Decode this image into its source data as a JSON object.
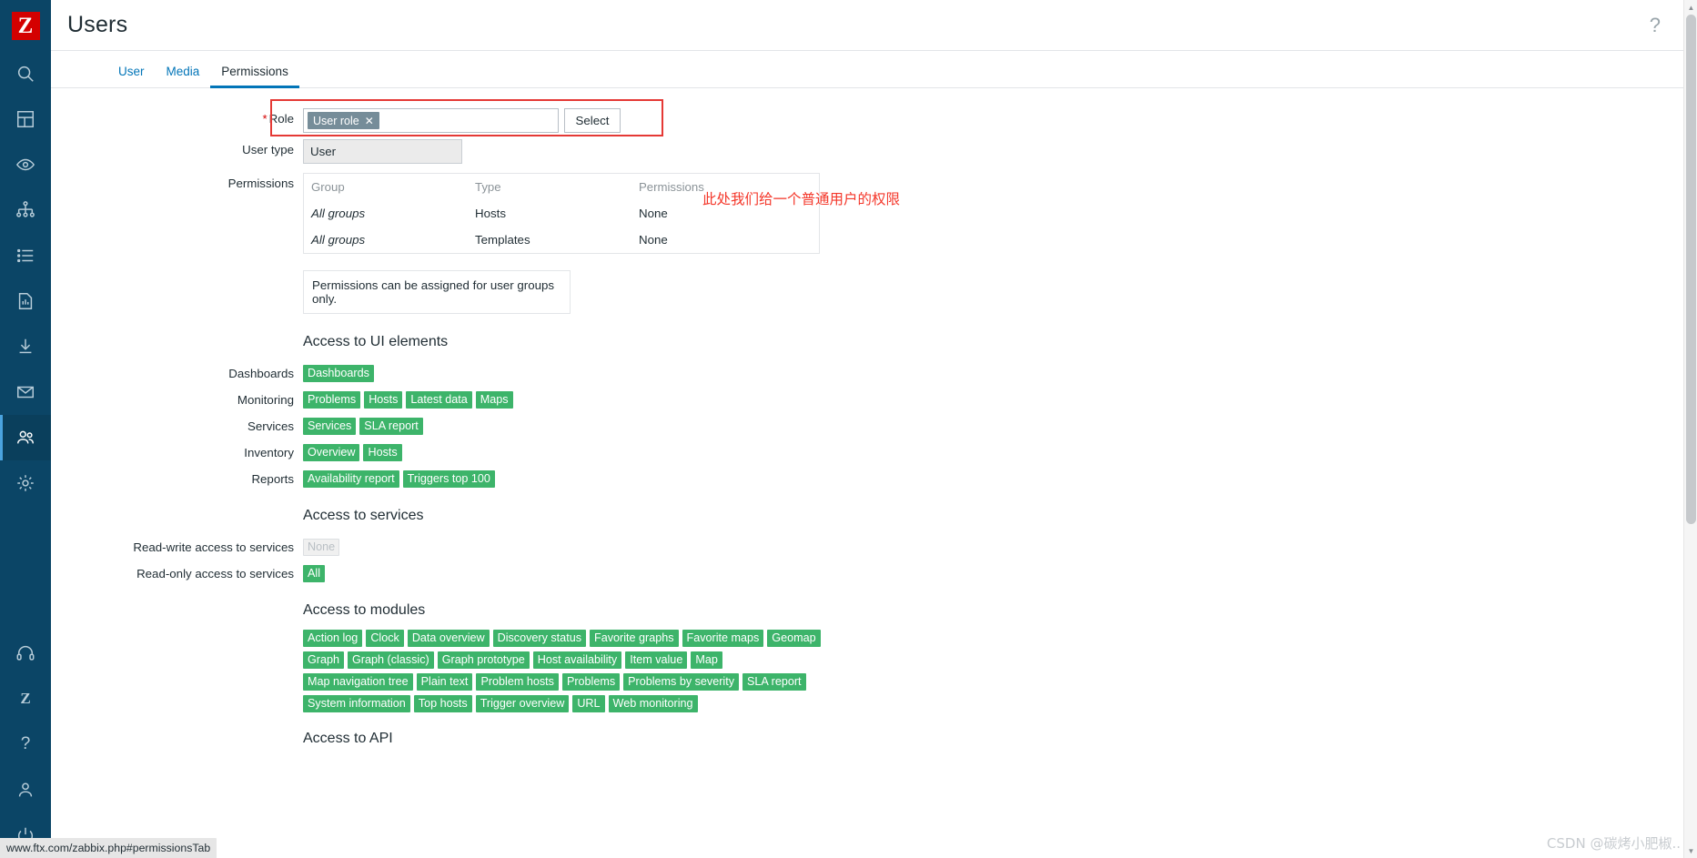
{
  "app": {
    "logo_letter": "Z",
    "page_title": "Users",
    "help_icon": "?"
  },
  "sidebar": {
    "items": [
      {
        "name": "search",
        "icon": "search-icon"
      },
      {
        "name": "dashboards",
        "icon": "dashboard-grid-icon"
      },
      {
        "name": "monitoring",
        "icon": "eye-icon"
      },
      {
        "name": "services",
        "icon": "hierarchy-icon"
      },
      {
        "name": "inventory",
        "icon": "list-icon"
      },
      {
        "name": "reports",
        "icon": "report-chart-icon"
      },
      {
        "name": "data-collection",
        "icon": "download-icon"
      },
      {
        "name": "alerts",
        "icon": "envelope-icon"
      },
      {
        "name": "users",
        "icon": "users-icon",
        "active": true
      },
      {
        "name": "administration",
        "icon": "gear-icon"
      }
    ],
    "bottom_items": [
      {
        "name": "support",
        "icon": "headset-icon"
      },
      {
        "name": "integrations",
        "icon": "zabbix-z-icon"
      },
      {
        "name": "help",
        "icon": "question-icon"
      },
      {
        "name": "user-settings",
        "icon": "person-icon"
      },
      {
        "name": "sign-out",
        "icon": "power-icon"
      }
    ]
  },
  "tabs": [
    {
      "label": "User",
      "active": false
    },
    {
      "label": "Media",
      "active": false
    },
    {
      "label": "Permissions",
      "active": true
    }
  ],
  "form": {
    "role": {
      "label": "Role",
      "required_marker": "*",
      "chip_value": "User role",
      "chip_remove": "✕",
      "select_button": "Select"
    },
    "user_type": {
      "label": "User type",
      "value": "User"
    },
    "permissions": {
      "label": "Permissions",
      "columns": [
        "Group",
        "Type",
        "Permissions"
      ],
      "rows": [
        {
          "group": "All groups",
          "type": "Hosts",
          "permission": "None"
        },
        {
          "group": "All groups",
          "type": "Templates",
          "permission": "None"
        }
      ],
      "note": "Permissions can be assigned for user groups only."
    }
  },
  "annotation": {
    "text": "此处我们给一个普通用户的权限",
    "color": "#f4372a"
  },
  "ui_elements": {
    "heading": "Access to UI elements",
    "groups": [
      {
        "label": "Dashboards",
        "tags": [
          "Dashboards"
        ]
      },
      {
        "label": "Monitoring",
        "tags": [
          "Problems",
          "Hosts",
          "Latest data",
          "Maps"
        ]
      },
      {
        "label": "Services",
        "tags": [
          "Services",
          "SLA report"
        ]
      },
      {
        "label": "Inventory",
        "tags": [
          "Overview",
          "Hosts"
        ]
      },
      {
        "label": "Reports",
        "tags": [
          "Availability report",
          "Triggers top 100"
        ]
      }
    ]
  },
  "services_access": {
    "heading": "Access to services",
    "rows": [
      {
        "label": "Read-write access to services",
        "tags": [
          "None"
        ],
        "disabled": true
      },
      {
        "label": "Read-only access to services",
        "tags": [
          "All"
        ],
        "disabled": false
      }
    ]
  },
  "modules_access": {
    "heading": "Access to modules",
    "tags": [
      "Action log",
      "Clock",
      "Data overview",
      "Discovery status",
      "Favorite graphs",
      "Favorite maps",
      "Geomap",
      "Graph",
      "Graph (classic)",
      "Graph prototype",
      "Host availability",
      "Item value",
      "Map",
      "Map navigation tree",
      "Plain text",
      "Problem hosts",
      "Problems",
      "Problems by severity",
      "SLA report",
      "System information",
      "Top hosts",
      "Trigger overview",
      "URL",
      "Web monitoring"
    ]
  },
  "api_access": {
    "heading": "Access to API"
  },
  "statusbar": {
    "url": "www.ftx.com/zabbix.php#permissionsTab"
  },
  "watermark": {
    "text": "CSDN @碳烤小肥椒.."
  },
  "colors": {
    "sidebar": "#0b4566",
    "logo": "#d40000",
    "tag_green": "#3db46a",
    "accent_blue": "#0275b8",
    "annotation_red": "#f4372a",
    "chip_grey": "#768d99"
  }
}
